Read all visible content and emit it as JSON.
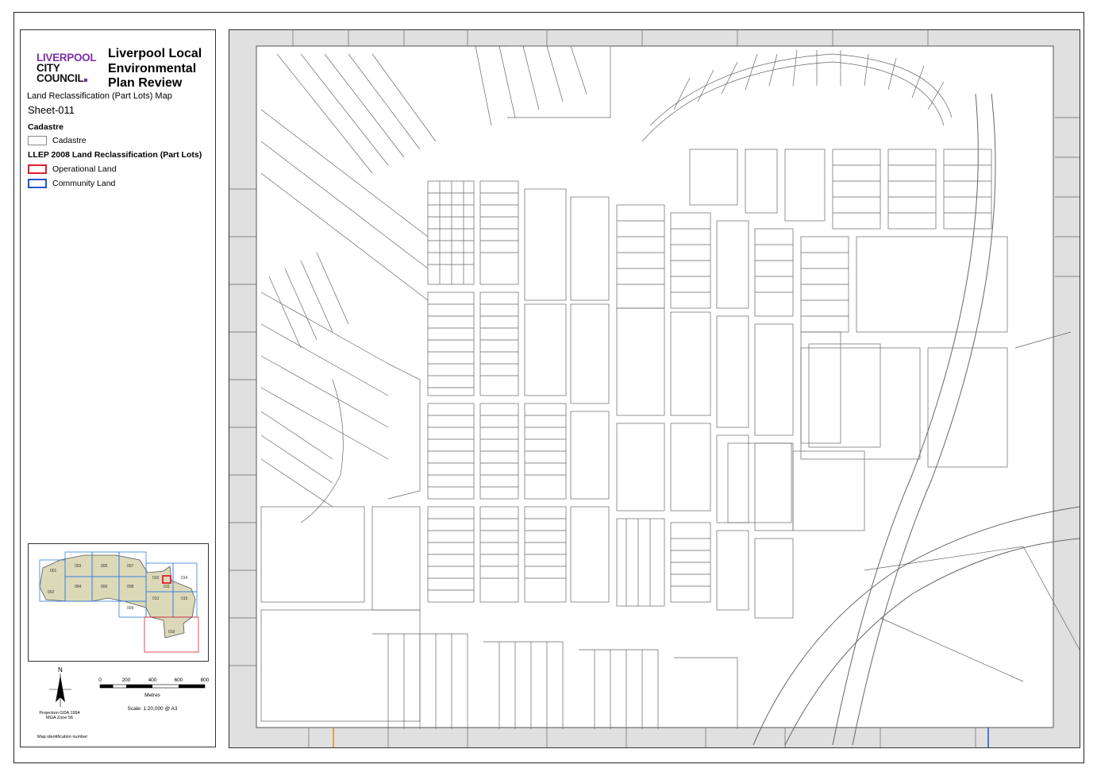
{
  "logo": {
    "line1": "LIVERPOOL",
    "line2": "CITY",
    "line3": "COUNCIL"
  },
  "title": {
    "line1": "Liverpool Local",
    "line2": "Environmental",
    "line3": "Plan Review"
  },
  "subtitle": "Land  Reclassification (Part Lots) Map",
  "sheet": "Sheet-011",
  "legend": {
    "section1": "Cadastre",
    "items1": [
      {
        "label": "Cadastre",
        "color": "#888888"
      }
    ],
    "section2": "LLEP 2008 Land  Reclassification (Part Lots)",
    "items2": [
      {
        "label": "Operational Land",
        "color": "#e0202a"
      },
      {
        "label": "Community Land",
        "color": "#1a56d6"
      }
    ]
  },
  "inset": {
    "sheets": [
      "001",
      "002",
      "003",
      "004",
      "005",
      "006",
      "007",
      "008",
      "009",
      "010",
      "011",
      "013",
      "014",
      "015",
      "016"
    ],
    "highlight_color": "#e0202a",
    "fill_color": "#dcd9b9",
    "grid_color": "#2f7fe0"
  },
  "scale": {
    "ticks": [
      "0",
      "200",
      "400",
      "600",
      "800"
    ],
    "unit": "Metres",
    "ratio": "Scale: 1:20,000 @ A3"
  },
  "north_label": "N",
  "projection": {
    "line1": "Projection GDA 1994",
    "line2": "MGA Zone 56"
  },
  "map_id": "Map identification number:"
}
